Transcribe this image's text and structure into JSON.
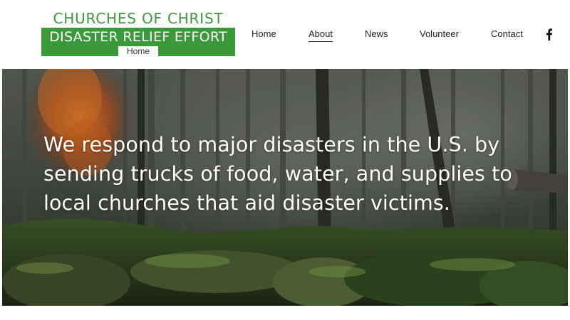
{
  "logo": {
    "line1": "CHURCHES OF CHRIST",
    "line2": "DISASTER RELIEF EFFORT",
    "home_tag": "Home"
  },
  "nav": {
    "items": [
      {
        "label": "Home",
        "active": false
      },
      {
        "label": "About",
        "active": true
      },
      {
        "label": "News",
        "active": false
      },
      {
        "label": "Volunteer",
        "active": false
      },
      {
        "label": "Contact",
        "active": false
      }
    ],
    "social_icon": "facebook-icon"
  },
  "hero": {
    "headline": "We respond to major disasters in the U.S. by sending trucks of food, water, and supplies to local churches that aid disaster victims."
  },
  "colors": {
    "brand_green": "#3a9a3a",
    "nav_text": "#222222",
    "hero_text": "#ffffff"
  }
}
